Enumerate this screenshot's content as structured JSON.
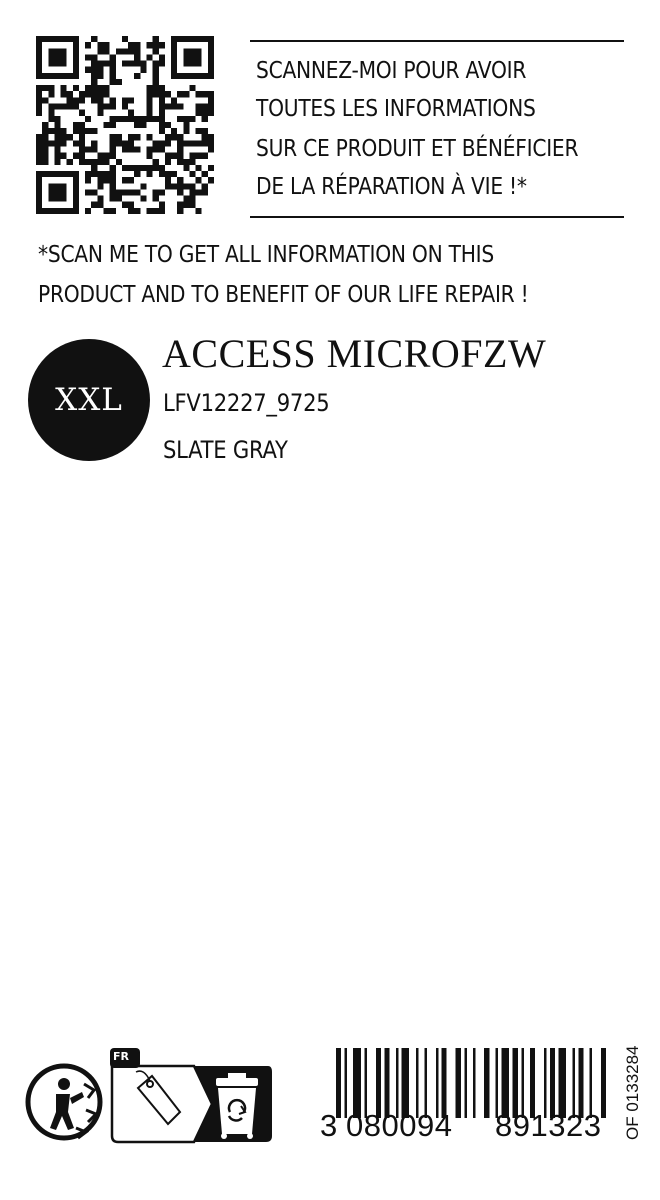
{
  "scan_block": {
    "fr_lines": [
      "SCANNEZ-MOI POUR AVOIR",
      "TOUTES LES INFORMATIONS",
      "SUR CE PRODUIT ET BÉNÉFICIER",
      "DE LA RÉPARATION À VIE !*"
    ],
    "en_lines": [
      "*SCAN ME TO GET ALL INFORMATION ON THIS",
      "PRODUCT AND TO BENEFIT OF OUR LIFE REPAIR !"
    ]
  },
  "product": {
    "size": "XXL",
    "name": "ACCESS MICROFZW",
    "reference": "LFV12227_9725",
    "color": "SLATE GRAY"
  },
  "recycling": {
    "triman_icon": "triman-icon",
    "country_badge": "FR",
    "tag_icon": "tag-icon",
    "bin_icon": "recycle-bin-icon"
  },
  "barcode": {
    "digit_first": "3",
    "digits_left": "080094",
    "digits_right": "891323",
    "side_code": "OF 0133284"
  }
}
